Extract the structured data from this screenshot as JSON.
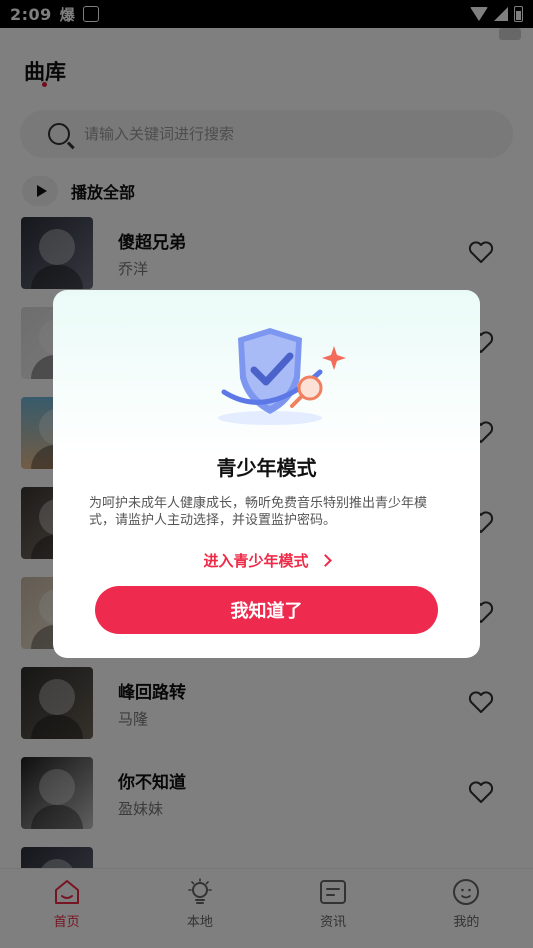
{
  "status_bar": {
    "time": "2:09",
    "app_label": "爆"
  },
  "header": {
    "title": "曲库"
  },
  "search": {
    "placeholder": "请输入关键词进行搜索"
  },
  "play_all": {
    "label": "播放全部"
  },
  "songs": [
    {
      "title": "傻超兄弟",
      "artist": "乔洋"
    },
    {
      "title": "",
      "artist": ""
    },
    {
      "title": "",
      "artist": ""
    },
    {
      "title": "",
      "artist": ""
    },
    {
      "title": "",
      "artist": ""
    },
    {
      "title": "峰回路转",
      "artist": "马隆"
    },
    {
      "title": "你不知道",
      "artist": "盈妹妹"
    },
    {
      "title": "",
      "artist": ""
    }
  ],
  "nav": [
    {
      "label": "首页",
      "icon": "home-icon",
      "active": true
    },
    {
      "label": "本地",
      "icon": "bulb-icon",
      "active": false
    },
    {
      "label": "资讯",
      "icon": "news-icon",
      "active": false
    },
    {
      "label": "我的",
      "icon": "profile-icon",
      "active": false
    }
  ],
  "dialog": {
    "title": "青少年模式",
    "description": "为呵护未成年人健康成长，畅听免费音乐特别推出青少年模式，请监护人主动选择，并设置监护密码。",
    "link": "进入青少年模式",
    "button": "我知道了"
  },
  "colors": {
    "accent": "#ee2a4f",
    "overlay": "rgba(0,0,0,0.5)"
  }
}
